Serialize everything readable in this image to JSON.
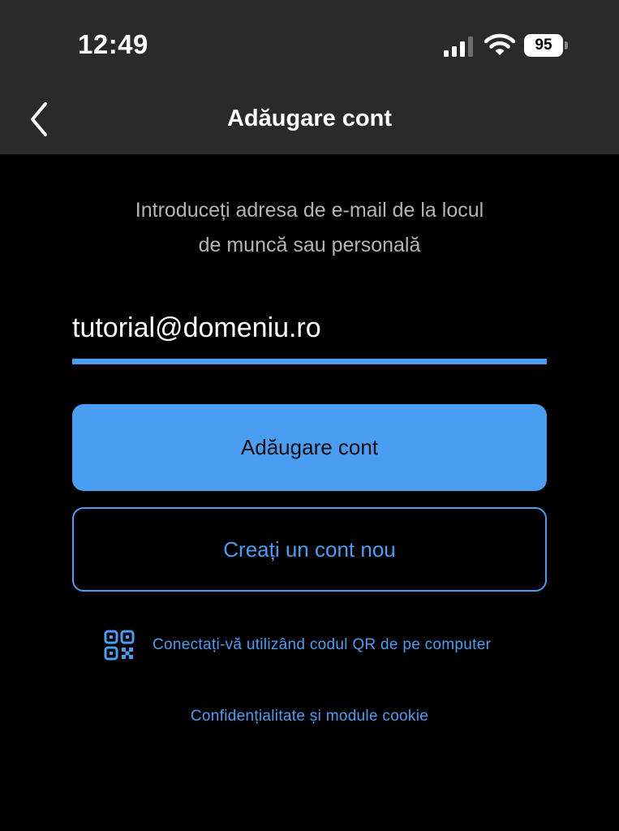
{
  "status_bar": {
    "time": "12:49",
    "battery_level": "95",
    "signal_icon": "cellular-signal-icon",
    "wifi_icon": "wifi-icon"
  },
  "nav": {
    "back_icon": "chevron-left-icon",
    "title": "Adăugare cont"
  },
  "instructions": {
    "line1": "Introduceți adresa de e-mail de la locul",
    "line2": "de muncă sau personală"
  },
  "email_field": {
    "value": "tutorial@domeniu.ro"
  },
  "buttons": {
    "add_account": "Adăugare cont",
    "create_account": "Creați un cont nou"
  },
  "qr_link": {
    "icon": "qr-code-icon",
    "label": "Conectați-vă utilizând codul QR de pe computer"
  },
  "privacy_link": {
    "label": "Confidențialitate și module cookie"
  },
  "colors": {
    "accent": "#4a9ef2",
    "background": "#000000",
    "header": "#2a2a2a",
    "muted_text": "#b4b4b4"
  }
}
